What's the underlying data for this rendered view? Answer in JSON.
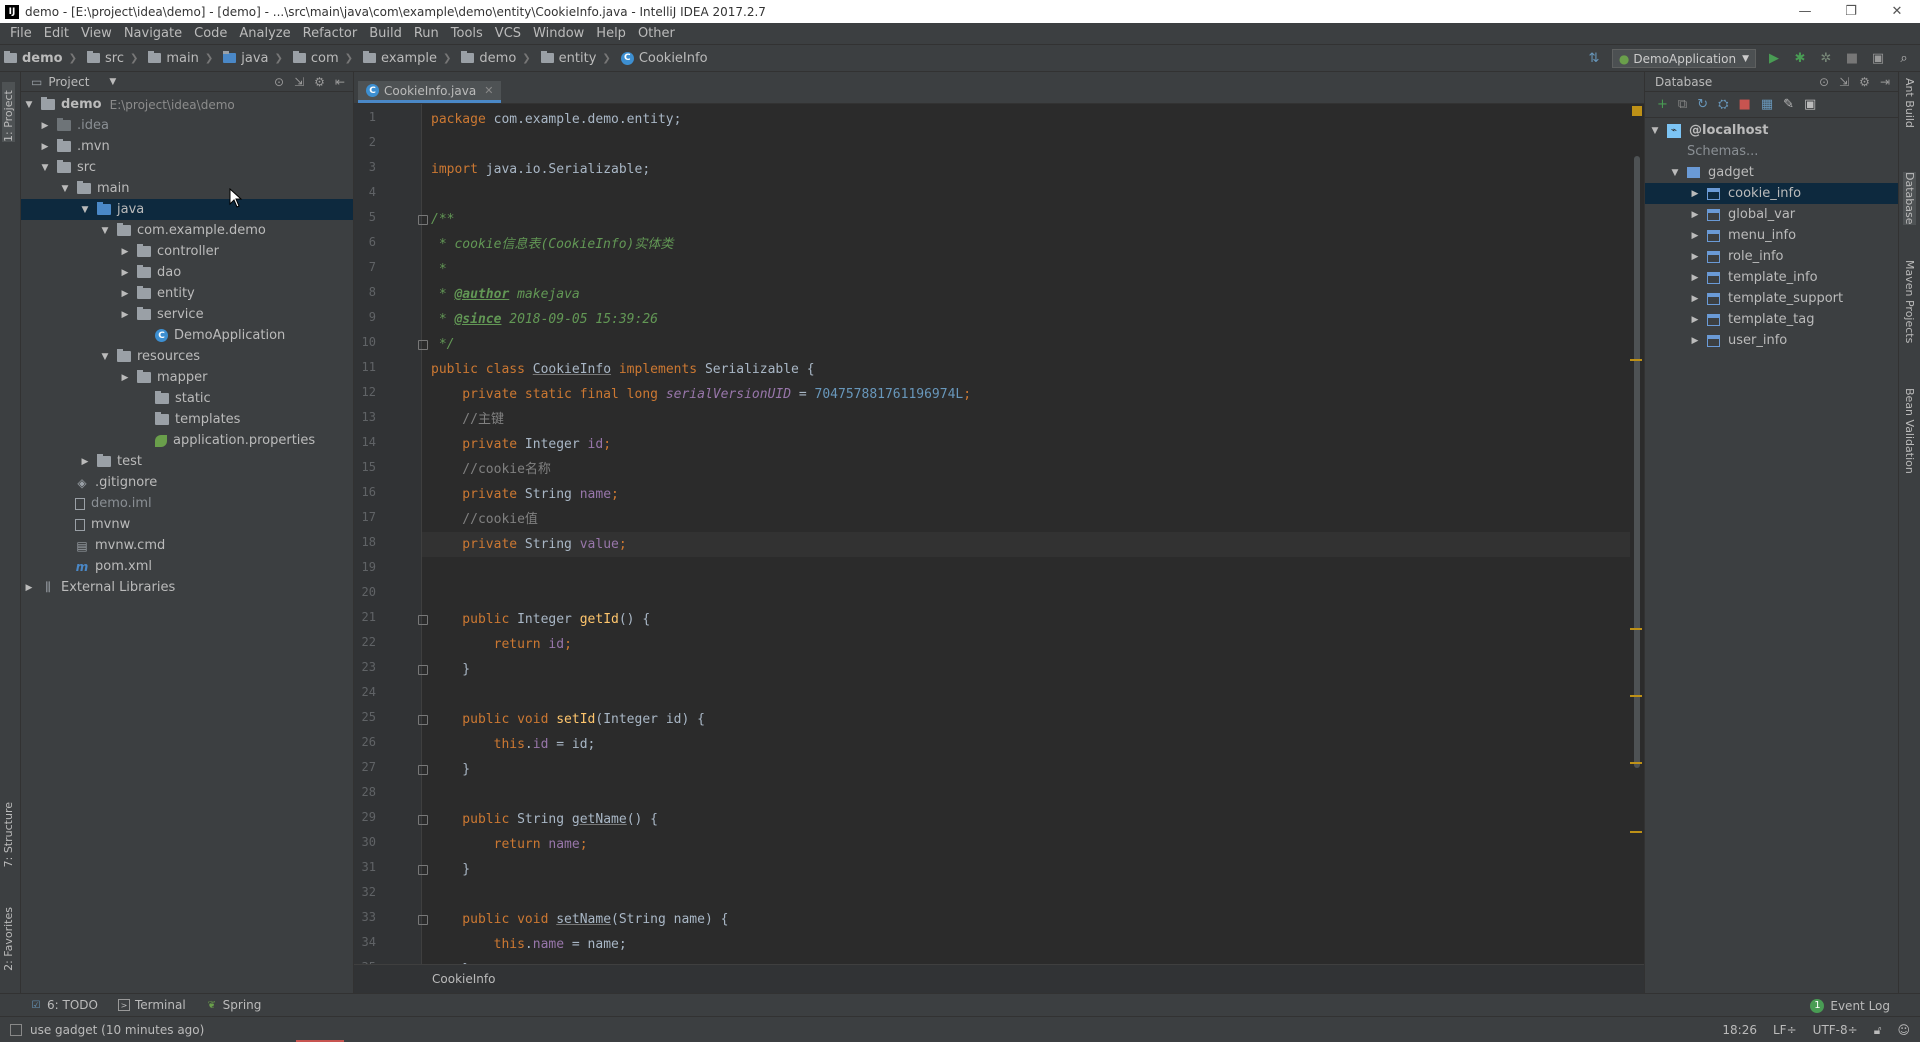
{
  "window": {
    "title": "demo - [E:\\project\\idea\\demo] - [demo] - ...\\src\\main\\java\\com\\example\\demo\\entity\\CookieInfo.java - IntelliJ IDEA 2017.2.7",
    "app_badge": "IJ",
    "minimize": "—",
    "restore": "❐",
    "close": "✕"
  },
  "menu": [
    "File",
    "Edit",
    "View",
    "Navigate",
    "Code",
    "Analyze",
    "Refactor",
    "Build",
    "Run",
    "Tools",
    "VCS",
    "Window",
    "Help",
    "Other"
  ],
  "navbar": {
    "crumbs": [
      "demo",
      "src",
      "main",
      "java",
      "com",
      "example",
      "demo",
      "entity"
    ],
    "current_file": "CookieInfo",
    "run_config": "DemoApplication"
  },
  "project_panel": {
    "title": "Project",
    "tree": {
      "demo": "demo",
      "demo_path": "E:\\project\\idea\\demo",
      "idea": ".idea",
      "mvn": ".mvn",
      "src": "src",
      "main": "main",
      "java": "java",
      "package": "com.example.demo",
      "controller": "controller",
      "dao": "dao",
      "entity": "entity",
      "service": "service",
      "app_class": "DemoApplication",
      "resources": "resources",
      "mapper": "mapper",
      "static": "static",
      "templates": "templates",
      "app_props": "application.properties",
      "test": "test",
      "gitignore": ".gitignore",
      "demo_iml": "demo.iml",
      "mvnw": "mvnw",
      "mvnw_cmd": "mvnw.cmd",
      "pom": "pom.xml",
      "ext_libs": "External Libraries"
    }
  },
  "editor": {
    "tab_label": "CookieInfo.java",
    "breadcrumb": "CookieInfo",
    "code": {
      "l1_kw": "package",
      "l1_rest": " com.example.demo.entity;",
      "l3_kw": "import",
      "l3_rest": " java.io.Serializable;",
      "l5": "/**",
      "l6": " * cookie信息表(CookieInfo)实体类",
      "l7": " *",
      "l8_star": " * ",
      "l8_tag": "@author",
      "l8_val": " makejava",
      "l9_star": " * ",
      "l9_tag": "@since",
      "l9_val": " 2018-09-05 15:39:26",
      "l10": " */",
      "l11_kw": "public class ",
      "l11_name": "CookieInfo",
      "l11_kw2": " implements ",
      "l11_rest": "Serializable {",
      "l12_kw": "    private static final long ",
      "l12_fld": "serialVersionUID",
      "l12_eq": " = ",
      "l12_num": "704757881761196974L",
      "l12_semi": ";",
      "l13": "    //主键",
      "l14_kw": "    private ",
      "l14_type": "Integer ",
      "l14_fld": "id",
      "l14_semi": ";",
      "l15": "    //cookie名称",
      "l16_kw": "    private ",
      "l16_type": "String ",
      "l16_fld": "name",
      "l16_semi": ";",
      "l17": "    //cookie值",
      "l18_kw": "    private ",
      "l18_type": "String ",
      "l18_fld": "value",
      "l18_semi": ";",
      "l21_kw": "    public ",
      "l21_type": "Integer ",
      "l21_fn": "getId",
      "l21_rest": "() {",
      "l22_kw": "        return ",
      "l22_fld": "id",
      "l22_semi": ";",
      "l23": "    }",
      "l25_kw": "    public void ",
      "l25_fn": "setId",
      "l25_rest": "(Integer id) {",
      "l26_kw": "        this",
      "l26_dot": ".",
      "l26_fld": "id",
      "l26_rest": " = id;",
      "l27": "    }",
      "l29_kw": "    public ",
      "l29_type": "String ",
      "l29_fn": "getName",
      "l29_rest": "() {",
      "l30_kw": "        return ",
      "l30_fld": "name",
      "l30_semi": ";",
      "l31": "    }",
      "l33_kw": "    public void ",
      "l33_fn": "setName",
      "l33_rest": "(String name) {",
      "l34_kw": "        this",
      "l34_dot": ".",
      "l34_fld": "name",
      "l34_rest": " = name;",
      "l35": "    }"
    }
  },
  "database_panel": {
    "title": "Database",
    "host": "@localhost",
    "schemas": "Schemas...",
    "schema": "gadget",
    "tables": [
      "cookie_info",
      "global_var",
      "menu_info",
      "role_info",
      "template_info",
      "template_support",
      "template_tag",
      "user_info"
    ]
  },
  "left_tabs": {
    "project": "1: Project",
    "structure": "7: Structure",
    "favorites": "2: Favorites"
  },
  "right_tabs": {
    "ant": "Ant Build",
    "database": "Database",
    "maven": "Maven Projects",
    "bean": "Bean Validation"
  },
  "bottom_tools": {
    "todo": "6: TODO",
    "terminal": "Terminal",
    "spring": "Spring",
    "event_log": "Event Log",
    "event_count": "1"
  },
  "status": {
    "message": "use gadget (10 minutes ago)",
    "position": "18:26",
    "line_sep": "LF÷",
    "encoding": "UTF-8÷"
  }
}
